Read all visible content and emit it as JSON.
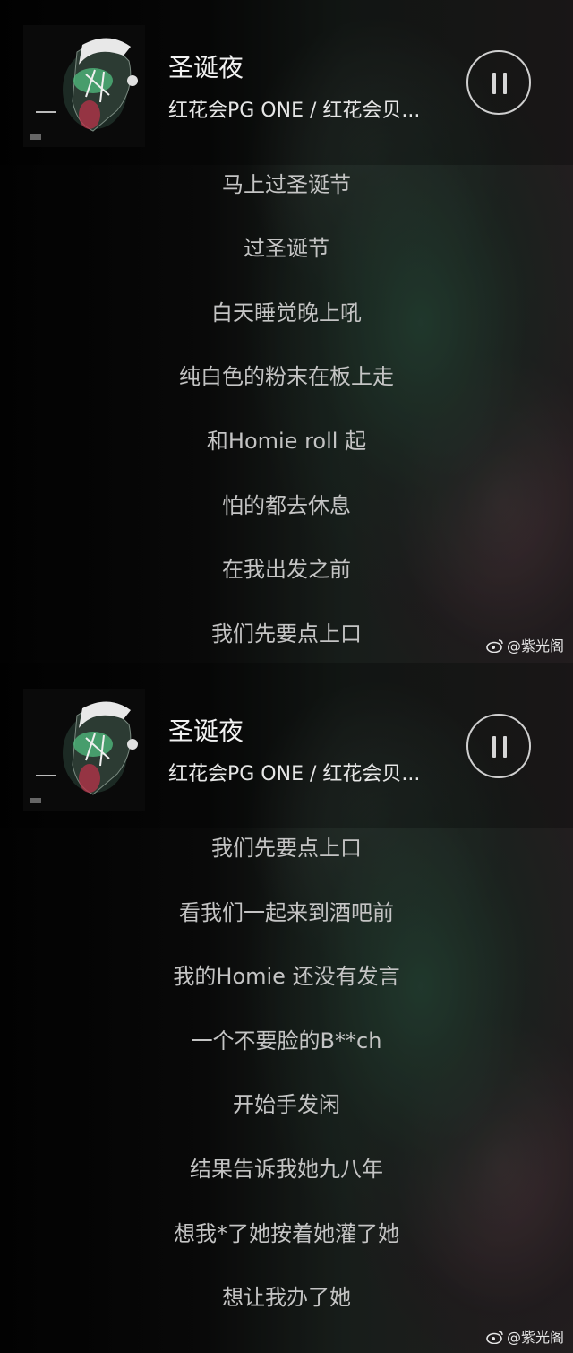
{
  "panels": [
    {
      "song": {
        "title": "圣诞夜",
        "artist": "红花会PG ONE / 红花会贝..."
      },
      "lyrics": [
        "马上过圣诞节",
        "过圣诞节",
        "白天睡觉晚上吼",
        "纯白色的粉末在板上走",
        "和Homie roll 起",
        "怕的都去休息",
        "在我出发之前",
        "我们先要点上口"
      ],
      "watermark": "@紫光阁"
    },
    {
      "song": {
        "title": "圣诞夜",
        "artist": "红花会PG ONE / 红花会贝..."
      },
      "lyrics": [
        "我们先要点上口",
        "看我们一起来到酒吧前",
        "我的Homie 还没有发言",
        "一个不要脸的B**ch",
        "开始手发闲",
        "结果告诉我她九八年",
        "想我*了她按着她灌了她",
        "想让我办了她"
      ],
      "watermark": "@紫光阁"
    }
  ],
  "icons": {
    "player_control": "pause-icon",
    "cover": "album-cover-icon",
    "watermark_logo": "weibo-icon"
  },
  "colors": {
    "lyric_text": "#c4c4c4",
    "title_text": "#f2f2f2",
    "background": "#000000"
  }
}
